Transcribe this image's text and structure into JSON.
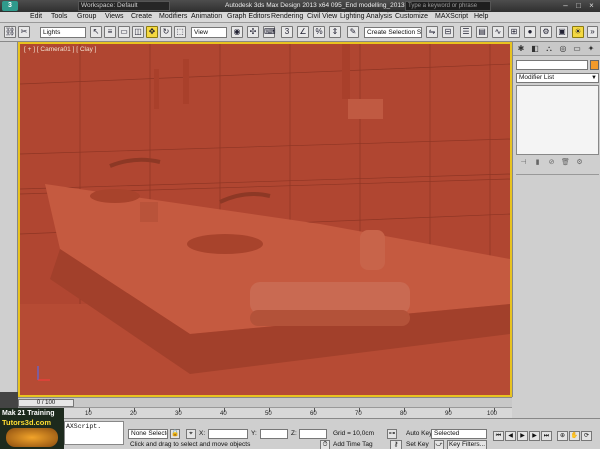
{
  "titlebar": {
    "workspace": "Workspace: Default",
    "title": "Autodesk 3ds Max Design 2013 x64     095_End modelling_2013.max",
    "search_placeholder": "Type a keyword or phrase"
  },
  "menu": [
    "Edit",
    "Tools",
    "Group",
    "Views",
    "Create",
    "Modifiers",
    "Animation",
    "Graph Editors",
    "Rendering",
    "Civil View",
    "Lighting Analysis",
    "Customize",
    "MAXScript",
    "Help"
  ],
  "toolbar": {
    "lights_select": "Lights",
    "view_select": "View",
    "selection_set": "Create Selection Se"
  },
  "viewport": {
    "label": "[ + ] [ Camera01 ] [ Clay ]"
  },
  "command_panel": {
    "modifier_list": "Modifier List"
  },
  "timeline": {
    "frame": "0 / 100",
    "ticks": [
      "0",
      "10",
      "20",
      "30",
      "40",
      "50",
      "60",
      "70",
      "80",
      "90",
      "100"
    ]
  },
  "status": {
    "maxscript": "AXScript.",
    "selection": "None Selected",
    "x_label": "X:",
    "y_label": "Y:",
    "z_label": "Z:",
    "grid": "Grid = 10,0cm",
    "hint": "Click and drag to select and move objects",
    "add_time_tag": "Add Time Tag",
    "auto_key": "Auto Key",
    "selected": "Selected",
    "set_key": "Set Key",
    "key_filters": "Key Filters..."
  },
  "watermark": {
    "line1": "Mak 21 Training",
    "line2": "Tutors3d.com"
  }
}
